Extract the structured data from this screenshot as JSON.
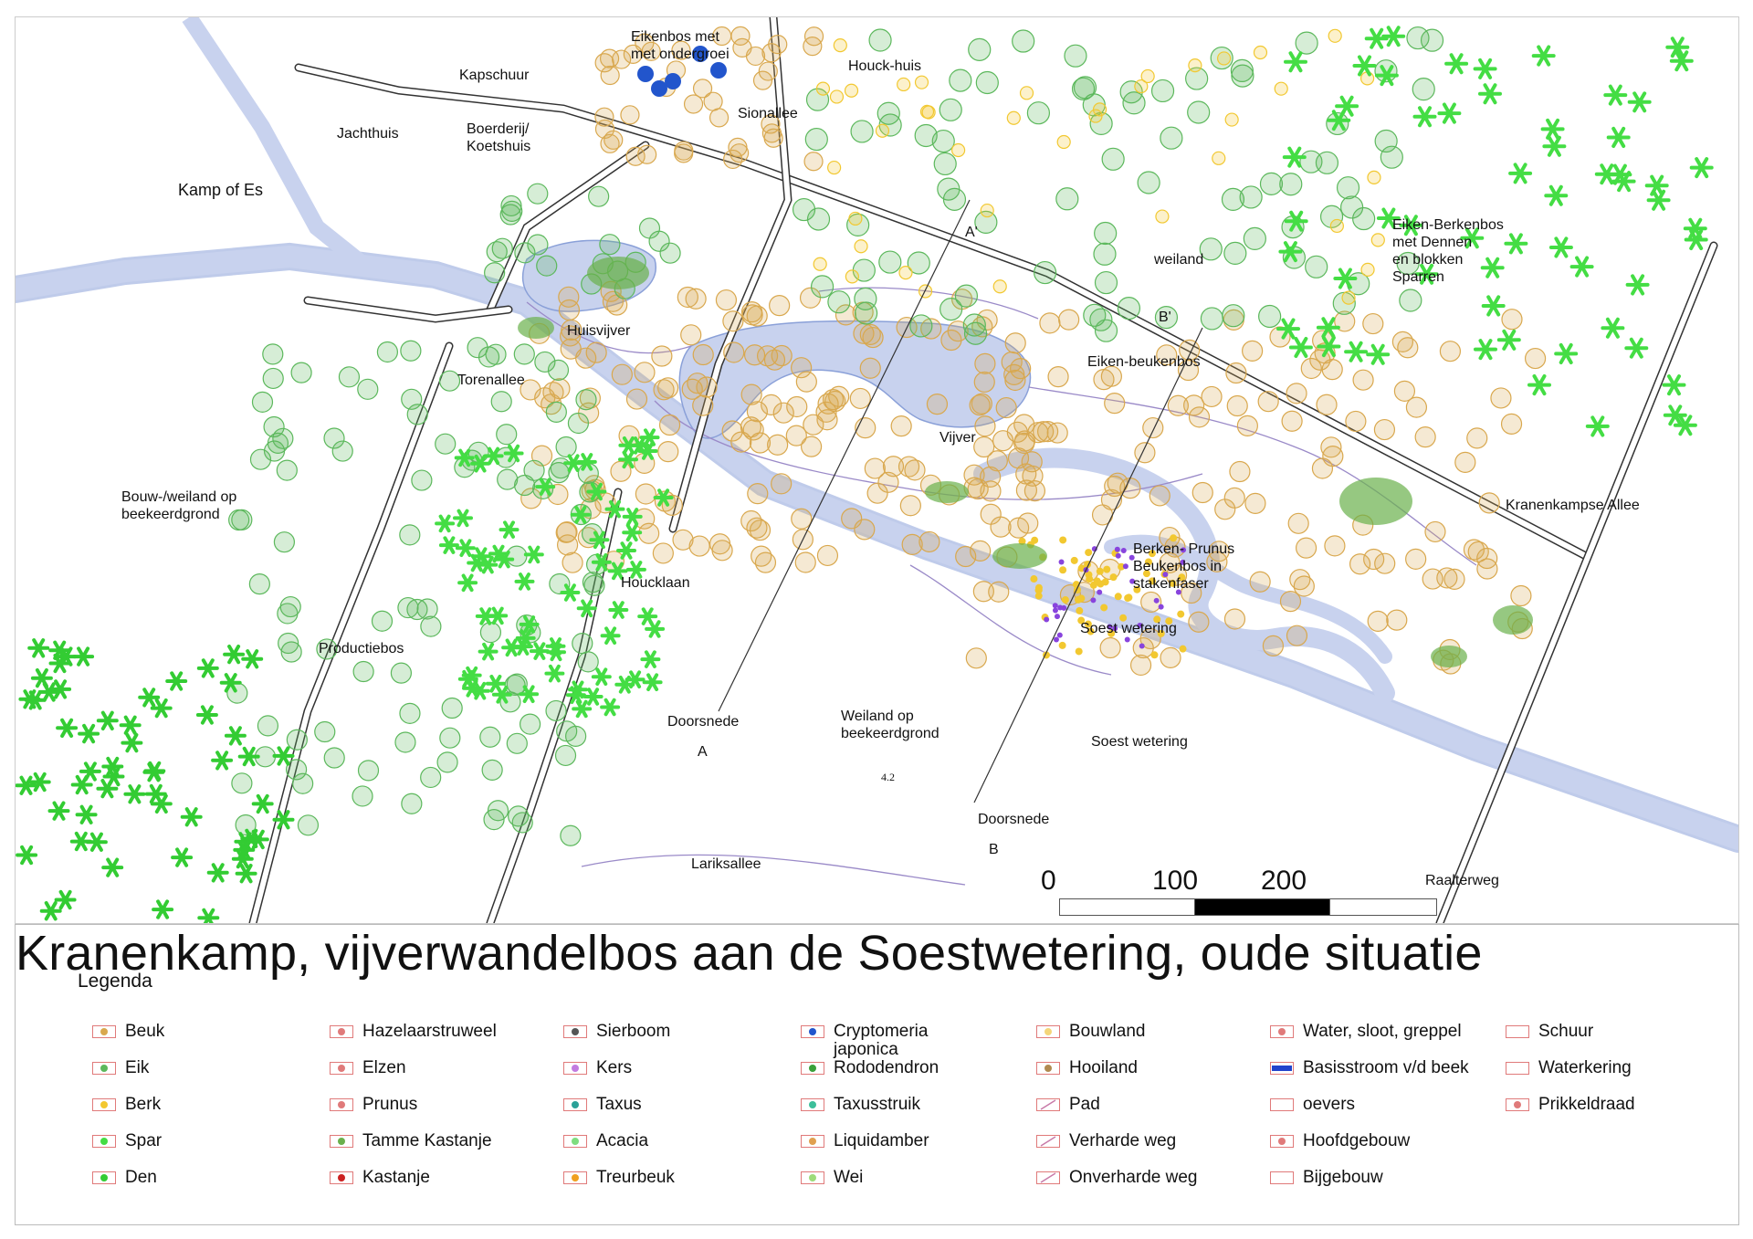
{
  "title": "Kranenkamp, vijverwandelbos aan de Soestwetering, oude situatie",
  "legend_title": "Legenda",
  "colors": {
    "water": "#c8d2ee",
    "water_stroke": "#8aa0d8",
    "beech": "#d9a84e",
    "oak": "#5cb85c",
    "birch": "#f2c830",
    "spruce": "#44dd44",
    "pine": "#33cc33",
    "rhododendron": "#6ab04c",
    "cryptomeria": "#2255cc",
    "kers": "#8844dd",
    "path": "#9a8ac8",
    "road": "#333333"
  },
  "map_labels": {
    "eikenbos": "Eikenbos met\nmet ondergroei",
    "kapschuur": "Kapschuur",
    "houckhuis": "Houck-huis",
    "jachthuis": "Jachthuis",
    "boerderij": "Boerderij/\nKoetshuis",
    "sionallee": "Sionallee",
    "kamp_of_es": "Kamp of Es",
    "a_prime": "A'",
    "weiland": "weiland",
    "eiken_berkenbos": "Eiken-Berkenbos\nmet Dennen\nen blokken\nSparren",
    "b_prime": "B'",
    "huisvijver": "Huisvijver",
    "eiken_beukenbos": "Eiken-beukenbos",
    "torenallee": "Torenallee",
    "vijver": "Vijver",
    "bouw_weiland": "Bouw-/weiland op\nbeekeerdgrond",
    "kranenkampse_allee": "Kranenkampse Allee",
    "berken_prunus": "Berken- Prunus\nBeukenbos in\nstakenfaser",
    "houcklaan": "Houcklaan",
    "soest_wetering_1": "Soest wetering",
    "productiebos": "Productiebos",
    "doorsnede_a": "Doorsnede",
    "a_label": "A",
    "weiland_beekeerd": "Weiland op\nbeekeerdgrond",
    "soest_wetering_2": "Soest wetering",
    "num_42": "4.2",
    "doorsnede_b": "Doorsnede",
    "b_label": "B",
    "lariksallee": "Lariksallee",
    "raalterweg": "Raalterweg"
  },
  "scalebar": {
    "labels": [
      "0",
      "100",
      "200"
    ]
  },
  "legend": [
    {
      "label": "Beuk",
      "icon": "beech-icon"
    },
    {
      "label": "Eik",
      "icon": "oak-icon"
    },
    {
      "label": "Berk",
      "icon": "birch-icon"
    },
    {
      "label": "Spar",
      "icon": "spruce-icon"
    },
    {
      "label": "Den",
      "icon": "pine-icon"
    },
    {
      "label": "Hazelaarstruweel",
      "icon": "hazel-icon"
    },
    {
      "label": "Elzen",
      "icon": "alder-icon"
    },
    {
      "label": "Prunus",
      "icon": "prunus-icon"
    },
    {
      "label": "Tamme Kastanje",
      "icon": "sweet-chestnut-icon"
    },
    {
      "label": "Kastanje",
      "icon": "chestnut-icon"
    },
    {
      "label": "Sierboom",
      "icon": "ornamental-tree-icon"
    },
    {
      "label": "Kers",
      "icon": "cherry-icon"
    },
    {
      "label": "Taxus",
      "icon": "yew-icon"
    },
    {
      "label": "Acacia",
      "icon": "acacia-icon"
    },
    {
      "label": "Treurbeuk",
      "icon": "weeping-beech-icon"
    },
    {
      "label": "Cryptomeria\njaponica",
      "icon": "cryptomeria-icon"
    },
    {
      "label": "Rododendron",
      "icon": "rhododendron-icon"
    },
    {
      "label": "Taxusstruik",
      "icon": "yew-shrub-icon"
    },
    {
      "label": "Liquidamber",
      "icon": "liquidambar-icon"
    },
    {
      "label": "Wei",
      "icon": "meadow-icon"
    },
    {
      "label": "Bouwland",
      "icon": "arable-land-icon"
    },
    {
      "label": "Hooiland",
      "icon": "hayfield-icon"
    },
    {
      "label": "Pad",
      "icon": "path-icon"
    },
    {
      "label": "Verharde weg",
      "icon": "paved-road-icon"
    },
    {
      "label": "Onverharde weg",
      "icon": "unpaved-road-icon"
    },
    {
      "label": "Water, sloot, greppel",
      "icon": "water-icon"
    },
    {
      "label": "Basisstroom v/d beek",
      "icon": "stream-icon"
    },
    {
      "label": "oevers",
      "icon": "bank-icon"
    },
    {
      "label": "Hoofdgebouw",
      "icon": "main-building-icon"
    },
    {
      "label": "Bijgebouw",
      "icon": "outbuilding-icon"
    },
    {
      "label": "Schuur",
      "icon": "barn-icon"
    },
    {
      "label": "Waterkering",
      "icon": "water-barrier-icon"
    },
    {
      "label": "Prikkeldraad",
      "icon": "barbed-wire-icon"
    }
  ]
}
